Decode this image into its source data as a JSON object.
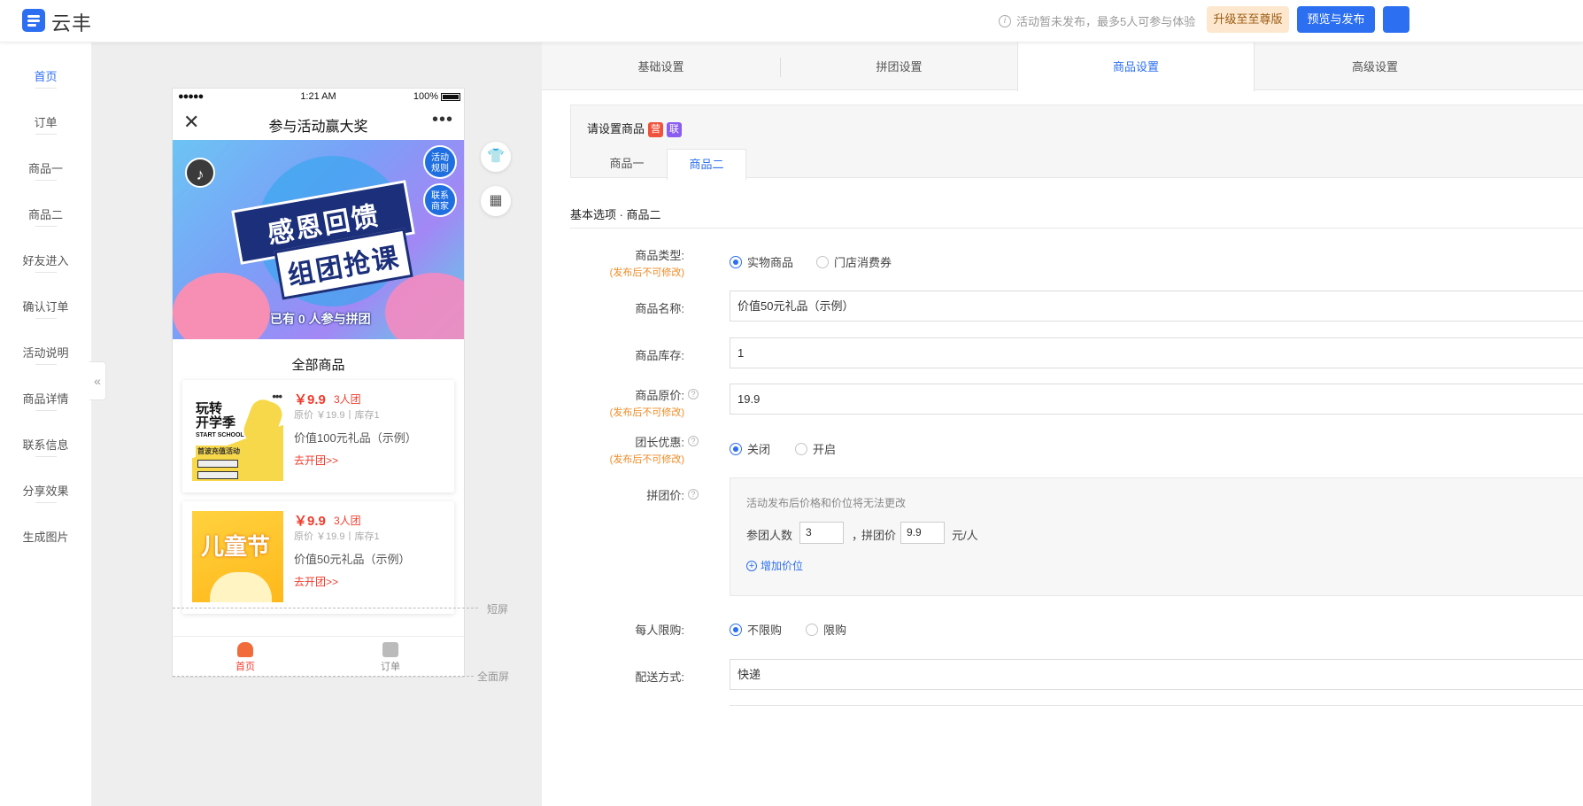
{
  "app": {
    "logo_text": "云丰",
    "notice": "活动暂未发布，最多5人可参与体验",
    "upgrade_label": "升级至至尊版",
    "preview_label": "预览与发布"
  },
  "sidebar": {
    "items": [
      {
        "label": "首页",
        "active": true
      },
      {
        "label": "订单"
      },
      {
        "label": "商品一"
      },
      {
        "label": "商品二"
      },
      {
        "label": "好友进入"
      },
      {
        "label": "确认订单"
      },
      {
        "label": "活动说明"
      },
      {
        "label": "商品详情"
      },
      {
        "label": "联系信息"
      },
      {
        "label": "分享效果"
      },
      {
        "label": "生成图片"
      }
    ],
    "collapse_glyph": "«"
  },
  "phone": {
    "status": {
      "signal": "●●●●●",
      "time": "1:21 AM",
      "battery": "100%"
    },
    "nav_title": "参与活动赢大奖",
    "close_glyph": "✕",
    "more_glyph": "•••",
    "banner": {
      "headline": "感恩回馈",
      "subline": "组团抢课",
      "joined": "已有 0 人参与拼团",
      "rules_badge": "活动\n规则",
      "contact_badge": "联系\n商家"
    },
    "section_title": "全部商品",
    "products": [
      {
        "price": "￥9.9",
        "group": "3人团",
        "meta": "原价 ￥19.9丨库存1",
        "name": "价值100元礼品（示例）",
        "cta": "去开团>>",
        "thumb_title": "玩转\n开学季",
        "thumb_sub": "START SCHOOL",
        "thumb_tag": "首波充值活动",
        "thumb_dots": "•••"
      },
      {
        "price": "￥9.9",
        "group": "3人团",
        "meta": "原价 ￥19.9丨库存1",
        "name": "价值50元礼品（示例）",
        "cta": "去开团>>",
        "thumb_title": "儿童节"
      }
    ],
    "tabbar": [
      {
        "label": "首页",
        "active": true
      },
      {
        "label": "订单"
      }
    ]
  },
  "guides": {
    "short": "短屏",
    "full": "全面屏"
  },
  "settings": {
    "tabs": [
      {
        "label": "基础设置"
      },
      {
        "label": "拼团设置"
      },
      {
        "label": "商品设置",
        "active": true
      },
      {
        "label": "高级设置"
      }
    ],
    "product_box": {
      "label": "请设置商品",
      "tag_ying": "营",
      "tag_lian": "联",
      "tabs": [
        {
          "label": "商品一"
        },
        {
          "label": "商品二",
          "active": true
        }
      ]
    },
    "section_title": "基本选项 · 商品二",
    "warn_text": "(发布后不可修改)",
    "fields": {
      "type": {
        "label": "商品类型:",
        "options": [
          "实物商品",
          "门店消费券"
        ],
        "selected": 0
      },
      "name": {
        "label": "商品名称:",
        "value": "价值50元礼品（示例）"
      },
      "stock": {
        "label": "商品库存:",
        "value": "1"
      },
      "original_price": {
        "label": "商品原价:",
        "value": "19.9"
      },
      "leader_discount": {
        "label": "团长优惠:",
        "options": [
          "关闭",
          "开启"
        ],
        "selected": 0
      },
      "group_price": {
        "label": "拼团价:",
        "hint": "活动发布后价格和价位将无法更改",
        "members_label": "参团人数",
        "members_value": "3",
        "sep": "，",
        "price_label": "拼团价",
        "price_value": "9.9",
        "unit": "元/人",
        "add_label": "增加价位"
      },
      "limit": {
        "label": "每人限购:",
        "options": [
          "不限购",
          "限购"
        ],
        "selected": 0
      },
      "delivery": {
        "label": "配送方式:",
        "value": "快递"
      }
    }
  },
  "colors": {
    "primary": "#2c6ff0",
    "price_red": "#f03c2d",
    "warn_orange": "#f08a24",
    "tag_red": "#f0523c",
    "tag_purple": "#8a5cf0"
  }
}
